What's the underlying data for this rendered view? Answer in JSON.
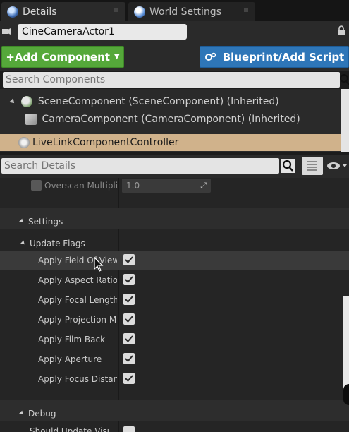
{
  "tabs": [
    {
      "label": "Details",
      "icon": "details-icon"
    },
    {
      "label": "World Settings",
      "icon": "world-settings-icon"
    }
  ],
  "actor": {
    "name": "CineCameraActor1"
  },
  "toolbar": {
    "add_component_label": "+Add Component",
    "blueprint_label": "Blueprint/Add Script"
  },
  "components_search": {
    "placeholder": "Search Components"
  },
  "component_tree": [
    {
      "label": "SceneComponent (SceneComponent) (Inherited)"
    },
    {
      "label": "CameraComponent (CameraComponent) (Inherited)"
    },
    {
      "label": "LiveLinkComponentController",
      "selected": true
    }
  ],
  "details_search": {
    "placeholder": "Search Details"
  },
  "details": {
    "overscan": {
      "label": "Overscan Multiplier",
      "value": "1.0"
    },
    "settings_label": "Settings",
    "update_flags_label": "Update Flags",
    "flags": [
      {
        "label": "Apply Field Of View",
        "checked": true
      },
      {
        "label": "Apply Aspect Ratio",
        "checked": true
      },
      {
        "label": "Apply Focal Length",
        "checked": true
      },
      {
        "label": "Apply Projection Mode",
        "checked": true
      },
      {
        "label": "Apply Film Back",
        "checked": true
      },
      {
        "label": "Apply Aperture",
        "checked": true
      },
      {
        "label": "Apply Focus Distance",
        "checked": true
      }
    ],
    "debug_label": "Debug",
    "partial_next_label": "Should Update Visual C"
  },
  "colors": {
    "add_button": "#55a83a",
    "blueprint_button": "#2e76b8",
    "selected_row": "#d0b28b",
    "panel_bg": "#252525"
  }
}
